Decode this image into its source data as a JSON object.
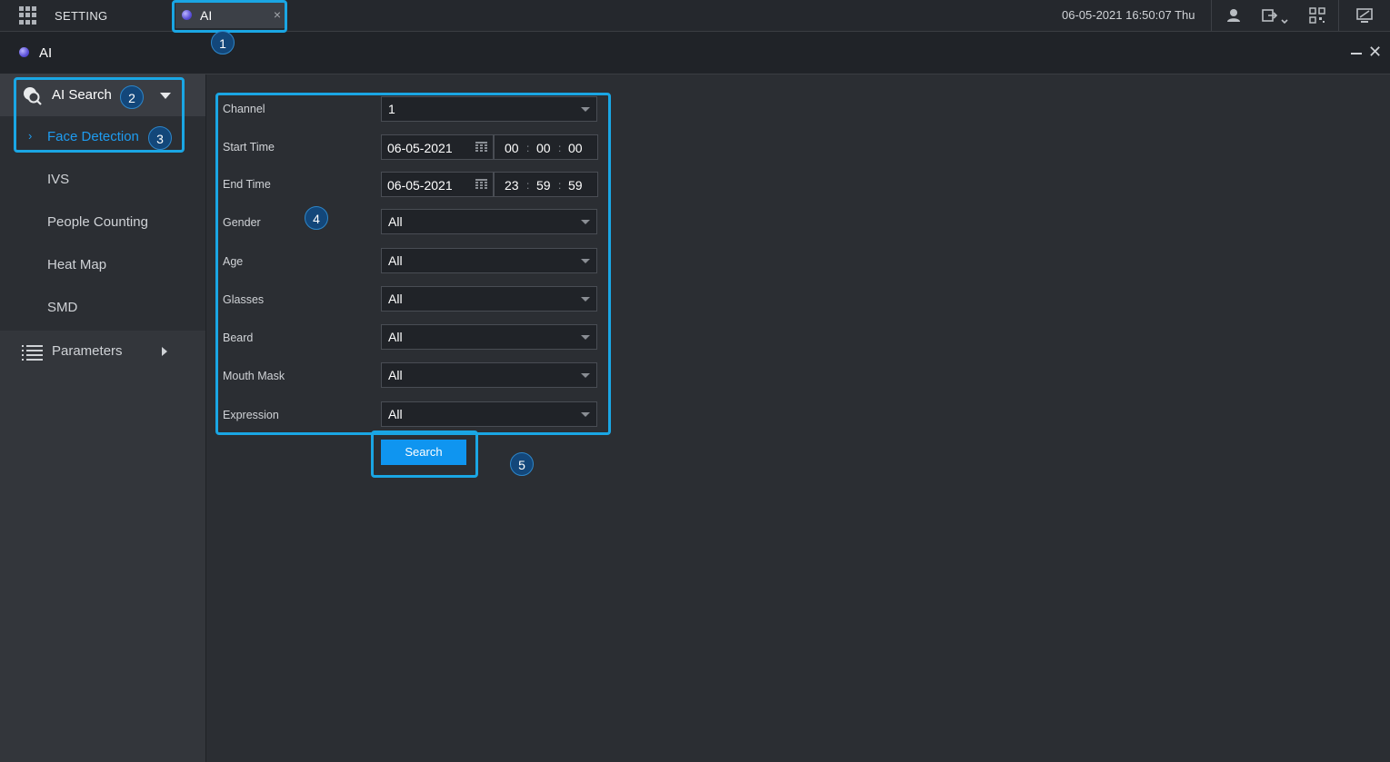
{
  "topbar": {
    "setting_label": "SETTING",
    "tab_label": "AI",
    "tab_close": "×",
    "datetime": "06-05-2021 16:50:07 Thu"
  },
  "window": {
    "title": "AI",
    "close": "✕"
  },
  "sidebar": {
    "group_label": "AI Search",
    "items": [
      {
        "label": "Face Detection",
        "active": true
      },
      {
        "label": "IVS"
      },
      {
        "label": "People Counting"
      },
      {
        "label": "Heat Map"
      },
      {
        "label": "SMD"
      }
    ],
    "parameters_label": "Parameters",
    "active_chevron": "›"
  },
  "form": {
    "channel": {
      "label": "Channel",
      "value": "1"
    },
    "start_time": {
      "label": "Start Time",
      "date": "06-05-2021",
      "h": "00",
      "m": "00",
      "s": "00"
    },
    "end_time": {
      "label": "End Time",
      "date": "06-05-2021",
      "h": "23",
      "m": "59",
      "s": "59"
    },
    "gender": {
      "label": "Gender",
      "value": "All"
    },
    "age": {
      "label": "Age",
      "value": "All"
    },
    "glasses": {
      "label": "Glasses",
      "value": "All"
    },
    "beard": {
      "label": "Beard",
      "value": "All"
    },
    "mouth_mask": {
      "label": "Mouth Mask",
      "value": "All"
    },
    "expression": {
      "label": "Expression",
      "value": "All"
    },
    "time_separator": ":",
    "search_label": "Search"
  },
  "annotations": {
    "m1": "1",
    "m2": "2",
    "m3": "3",
    "m4": "4",
    "m5": "5"
  },
  "colors": {
    "accent": "#1e9cf0",
    "highlight": "#1aa6e4",
    "button": "#0f95f0"
  }
}
